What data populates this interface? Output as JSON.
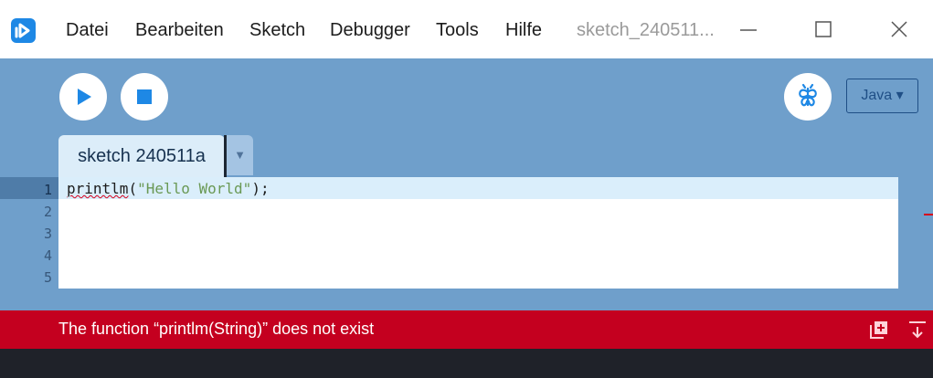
{
  "menubar": {
    "items": [
      {
        "label": "Datei"
      },
      {
        "label": "Bearbeiten"
      },
      {
        "label": "Sketch"
      },
      {
        "label": "Debugger"
      },
      {
        "label": "Tools"
      },
      {
        "label": "Hilfe"
      }
    ],
    "window_title": "sketch_240511...",
    "app_icon": "processing-logo-icon"
  },
  "toolbar": {
    "run_icon": "play-icon",
    "stop_icon": "stop-icon",
    "debug_icon": "butterfly-icon",
    "mode_label": "Java ▾"
  },
  "tabs": [
    {
      "label": "sketch 240511a",
      "active": true
    }
  ],
  "tab_menu_glyph": "▼",
  "editor": {
    "line_numbers": [
      "1",
      "2",
      "3",
      "4",
      "5"
    ],
    "active_line": 1,
    "code": {
      "fn": "printlm",
      "open": "(",
      "str": "\"Hello World\"",
      "close": ");"
    }
  },
  "status": {
    "message": "The function “printlm(String)” does not exist",
    "type": "error"
  },
  "colors": {
    "toolbar_bg": "#6f9fcb",
    "tab_bg": "#dcedf9",
    "active_line_bg": "#daeefb",
    "error_bg": "#c4001f",
    "accent": "#1e88e5"
  }
}
